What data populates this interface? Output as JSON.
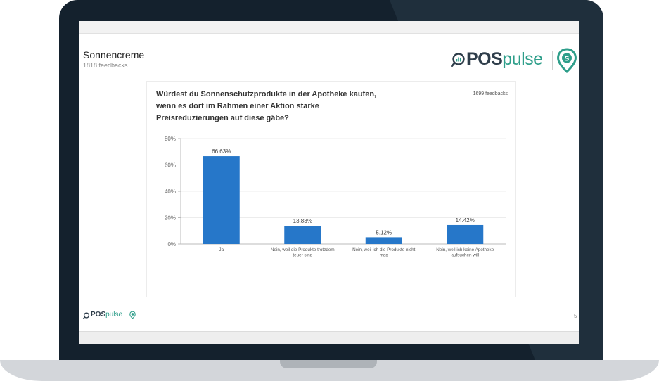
{
  "header": {
    "title": "Sonnencreme",
    "subtitle": "1818 feedbacks",
    "logo_bold": "POS",
    "logo_light": "pulse",
    "footer_logo_bold": "POS",
    "footer_logo_light": "pulse",
    "page_number": "5"
  },
  "card": {
    "question": "Würdest du Sonnenschutzprodukte in der Apotheke kaufen, wenn es dort im Rahmen einer Aktion starke Preisreduzierungen auf diese gäbe?",
    "feedbacks": "1699 feedbacks"
  },
  "colors": {
    "bar": "#2677c9",
    "accent": "#2e9e8a",
    "brand_dark": "#2e3d4a"
  },
  "chart_data": {
    "type": "bar",
    "title": "",
    "xlabel": "",
    "ylabel": "",
    "ylim": [
      0,
      80
    ],
    "yticks": [
      "0%",
      "20%",
      "40%",
      "60%",
      "80%"
    ],
    "categories": [
      "Ja",
      "Nein, weil die Produkte trotzdem teuer sind",
      "Nein, weil ich die Produkte nicht mag",
      "Nein, weil ich keine Apotheke aufsuchen will"
    ],
    "values": [
      66.63,
      13.83,
      5.12,
      14.42
    ],
    "labels": [
      "66.63%",
      "13.83%",
      "5.12%",
      "14.42%"
    ],
    "grid": true
  }
}
